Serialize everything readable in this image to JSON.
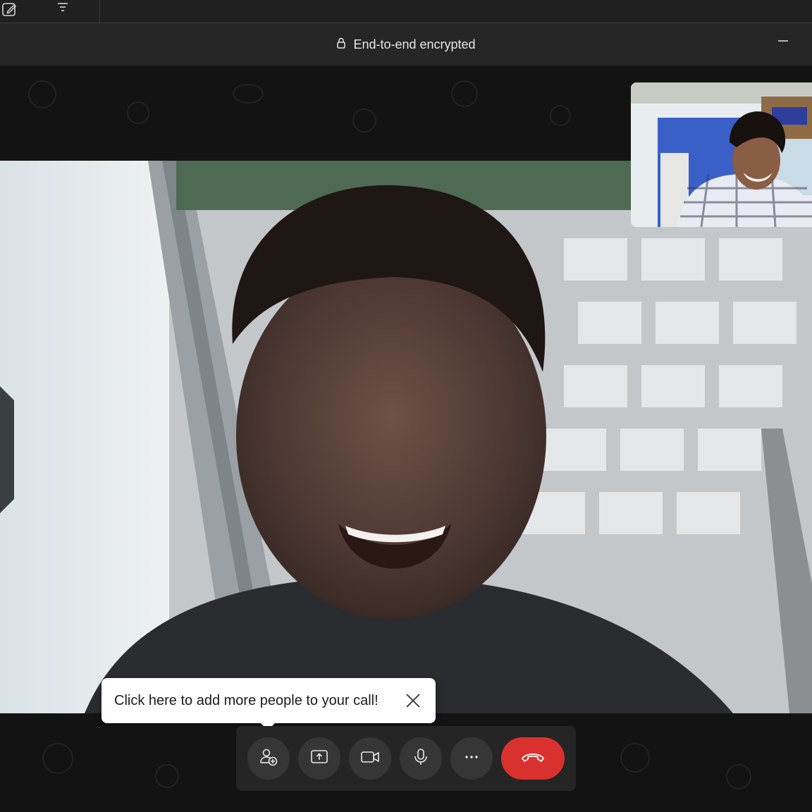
{
  "window": {
    "encryption_label": "End-to-end encrypted"
  },
  "icons": {
    "compose": "compose-icon",
    "filter": "filter-icon",
    "lock": "lock-icon",
    "minimize": "minimize-icon",
    "close": "close-icon",
    "add_people": "add-person-icon",
    "share_screen": "share-screen-icon",
    "camera": "camera-icon",
    "microphone": "microphone-icon",
    "more": "more-icon",
    "end_call": "hang-up-icon"
  },
  "tooltip": {
    "text": "Click here to add more people to your call!"
  },
  "colors": {
    "background": "#131313",
    "control_bar": "#252525",
    "control_button": "#363636",
    "end_call": "#d9322e",
    "tooltip_bg": "#ffffff"
  }
}
